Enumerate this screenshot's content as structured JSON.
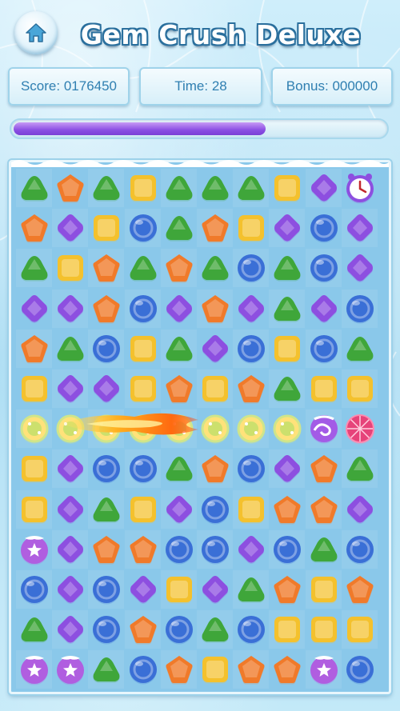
{
  "header": {
    "title": "Gem Crush Deluxe",
    "home_icon": "home-icon"
  },
  "stats": {
    "score": "Score: 0176450",
    "time": "Time: 28",
    "bonus": "Bonus: 000000"
  },
  "progress": {
    "value": 0.67,
    "color": "#8a4fe3"
  },
  "colors": {
    "green": "#3fa63a",
    "orange": "#f07a2a",
    "yellow": "#f4c12d",
    "purple": "#8d4fe0",
    "blue": "#3a6fd6",
    "board": "#8ac8ea"
  },
  "board": {
    "rows": 13,
    "cols": 10,
    "legend": {
      "G": "green-gem",
      "O": "orange-gem",
      "Y": "yellow-gem",
      "P": "purple-gem",
      "B": "blue-gem",
      "C": "clock-bonus",
      "F": "flame-gem",
      "W": "swirl-gem",
      "R": "red-burst-gem",
      "S": "star-gem"
    },
    "grid": [
      "GOGYGGGYPC",
      "OPYBGOYPBP",
      "GYOGOGBGBP",
      "PPOBPOPGPB",
      "OGBYGPBYBG",
      "YPPYOYOGYY",
      "FFFFFFFFWR",
      "YPBBGOBPOG",
      "YPGYPBYOOP",
      "SPOOBBPBGB",
      "BPBPYPGOYO",
      "GPBOBGBYYY",
      "SSGBOYOOSB"
    ]
  }
}
